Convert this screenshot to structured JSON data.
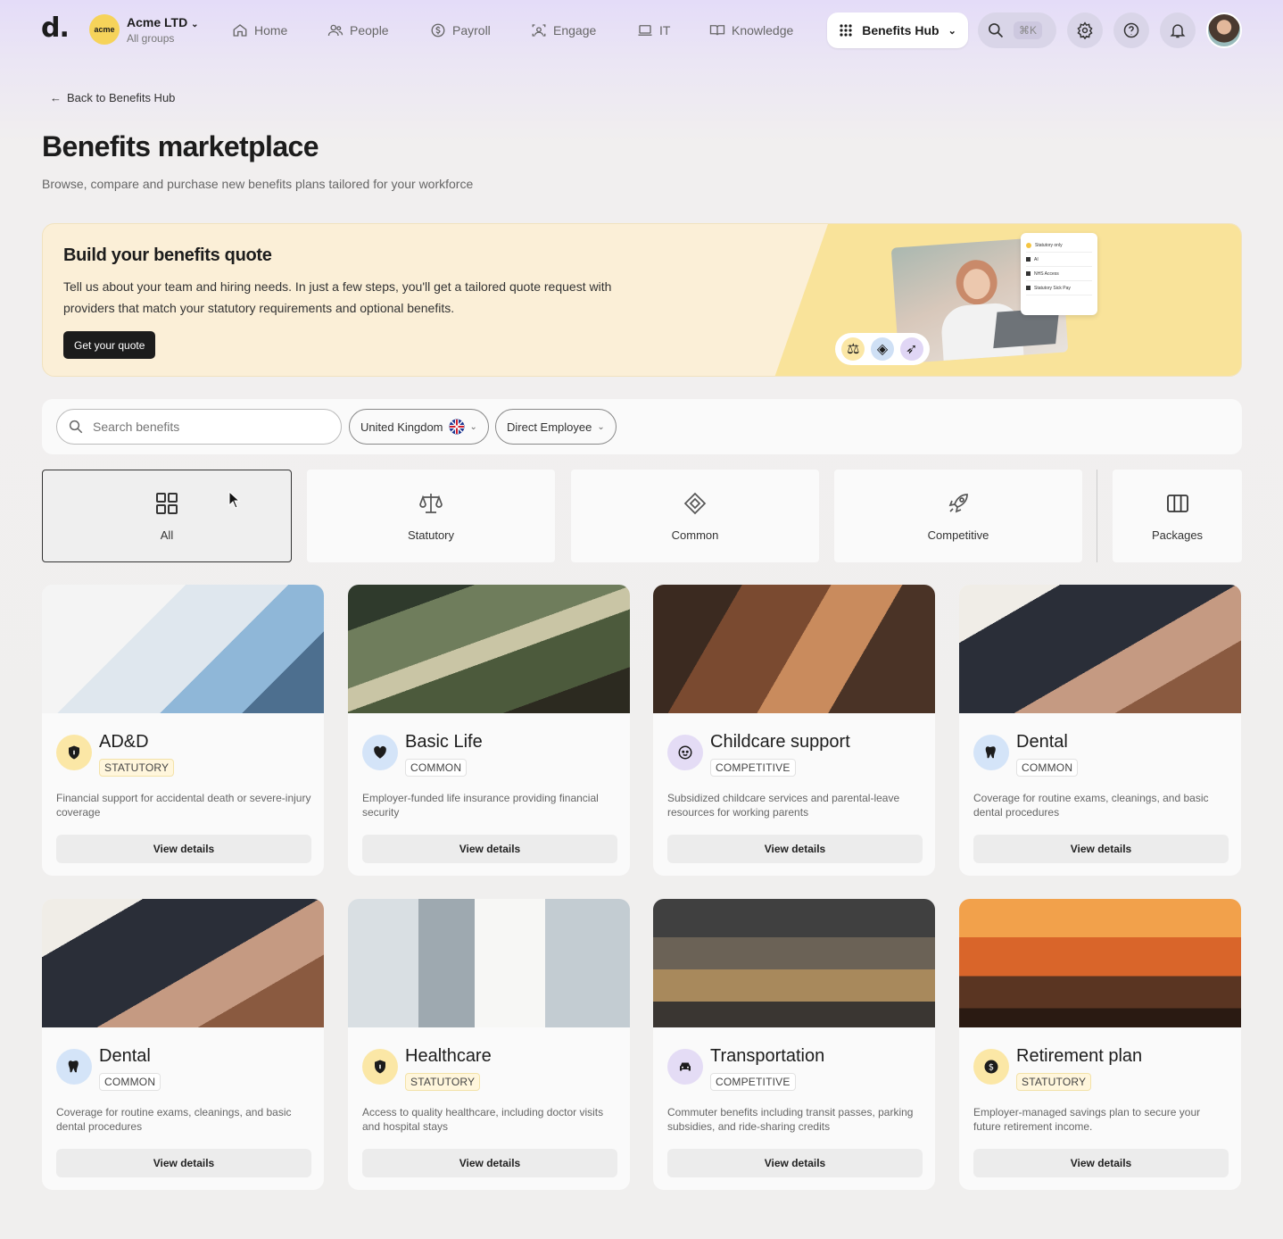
{
  "brand": {
    "logo": "d.",
    "org_badge": "acme",
    "org_name": "Acme LTD",
    "org_sub": "All groups"
  },
  "nav": {
    "home": "Home",
    "people": "People",
    "payroll": "Payroll",
    "engage": "Engage",
    "it": "IT",
    "knowledge": "Knowledge",
    "hub": "Benefits Hub",
    "shortcut": "⌘K"
  },
  "page": {
    "back": "Back to Benefits Hub",
    "title": "Benefits marketplace",
    "subtitle": "Browse, compare and purchase new benefits plans tailored for your workforce"
  },
  "banner": {
    "title": "Build your benefits quote",
    "text": "Tell us about your team and hiring needs. In just a few steps, you'll get a tailored quote request with providers that match your statutory requirements and optional benefits.",
    "button": "Get your quote",
    "card_items": [
      "Statutory only",
      "AI",
      "NHS Access",
      "Statutory Sick Pay"
    ]
  },
  "filters": {
    "search_placeholder": "Search benefits",
    "country": "United Kingdom",
    "employee_type": "Direct Employee"
  },
  "categories": [
    {
      "label": "All",
      "icon": "grid-icon",
      "selected": true
    },
    {
      "label": "Statutory",
      "icon": "scale-icon"
    },
    {
      "label": "Common",
      "icon": "tag-icon"
    },
    {
      "label": "Competitive",
      "icon": "rocket-icon"
    },
    {
      "label": "Packages",
      "icon": "columns-icon"
    }
  ],
  "cards": [
    {
      "title": "AD&D",
      "tag": "STATUTORY",
      "desc": "Financial support for accidental death or severe-injury coverage",
      "button": "View details",
      "icon": "shield-icon",
      "icon_bg": "#fbe7a6",
      "image": "doctors-photo"
    },
    {
      "title": "Basic Life",
      "tag": "COMMON",
      "desc": "Employer-funded life insurance providing financial security",
      "button": "View details",
      "icon": "heart-icon",
      "icon_bg": "#d4e4f8",
      "image": "house-walk-photo"
    },
    {
      "title": "Childcare support",
      "tag": "COMPETITIVE",
      "desc": "Subsidized childcare services and parental-leave resources for working parents",
      "button": "View details",
      "icon": "baby-icon",
      "icon_bg": "#e4dcf5",
      "image": "family-photo"
    },
    {
      "title": "Dental",
      "tag": "COMMON",
      "desc": "Coverage for routine exams, cleanings, and basic dental procedures",
      "button": "View details",
      "icon": "tooth-icon",
      "icon_bg": "#d4e4f8",
      "image": "dentist-photo"
    },
    {
      "title": "Dental",
      "tag": "COMMON",
      "desc": "Coverage for routine exams, cleanings, and basic dental procedures",
      "button": "View details",
      "icon": "tooth-icon",
      "icon_bg": "#d4e4f8",
      "image": "dentist-photo"
    },
    {
      "title": "Healthcare",
      "tag": "STATUTORY",
      "desc": "Access to quality healthcare, including doctor visits and hospital stays",
      "button": "View details",
      "icon": "shield-icon",
      "icon_bg": "#fbe7a6",
      "image": "doctor-photo"
    },
    {
      "title": "Transportation",
      "tag": "COMPETITIVE",
      "desc": "Commuter benefits including transit passes, parking subsidies, and ride-sharing credits",
      "button": "View details",
      "icon": "car-icon",
      "icon_bg": "#e4dcf5",
      "image": "traffic-photo"
    },
    {
      "title": "Retirement plan",
      "tag": "STATUTORY",
      "desc": "Employer-managed savings plan to secure your future retirement income.",
      "button": "View details",
      "icon": "dollar-icon",
      "icon_bg": "#fbe7a6",
      "image": "sunset-man-photo"
    }
  ]
}
